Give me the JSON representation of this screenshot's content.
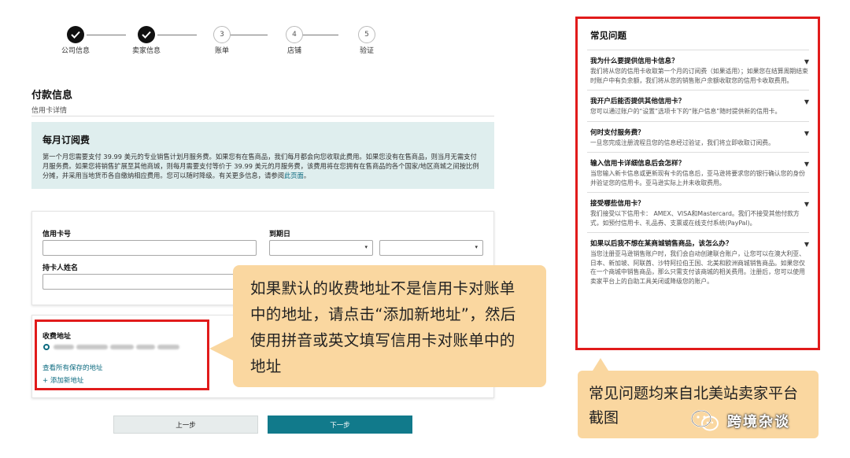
{
  "stepper": {
    "steps": [
      {
        "label": "公司信息",
        "number": "1",
        "state": "done"
      },
      {
        "label": "卖家信息",
        "number": "2",
        "state": "done"
      },
      {
        "label": "账单",
        "number": "3",
        "state": "todo"
      },
      {
        "label": "店铺",
        "number": "4",
        "state": "todo"
      },
      {
        "label": "验证",
        "number": "5",
        "state": "todo"
      }
    ]
  },
  "payment": {
    "title": "付款信息",
    "subtitle": "信用卡详情",
    "fee_title": "每月订阅费",
    "fee_text": "第一个月您需要支付 39.99 美元的专业销售计划月服务费。如果您有在售商品，我们每月都会向您收取此费用。如果您没有在售商品，则当月无需支付月服务费。如果您将销售扩展至其他商城，则每月需要支付等价于 39.99 美元的月服务费，该费用将在您拥有在售商品的各个国家/地区商城之间按比例分摊，并采用当地货币各自缴纳相应费用。您可以随时降级。有关更多信息，请参阅",
    "fee_link": "此页面",
    "fee_end": "。"
  },
  "form": {
    "card_number_label": "信用卡号",
    "card_number_value": "",
    "expiry_label": "到期日",
    "expiry_month": "",
    "expiry_year": "",
    "holder_label": "持卡人姓名",
    "holder_value": ""
  },
  "billing": {
    "label": "收费地址",
    "view_all": "查看所有保存的地址",
    "add_new": "+ 添加新地址"
  },
  "buttons": {
    "prev": "上一步",
    "next": "下一步"
  },
  "callout": {
    "text": "如果默认的收费地址不是信用卡对账单中的地址，请点击“添加新地址”，然后使用拼音或英文填写信用卡对账单中的地址"
  },
  "faq": {
    "title": "常见问题",
    "items": [
      {
        "q": "我为什么要提供信用卡信息？",
        "a": "我们将从您的信用卡收取第一个月的订阅费（如果适用）；如果您在结算周期结束时账户中有负余额，我们将从您的销售账户余额收取您的信用卡收取费用。"
      },
      {
        "q": "我开户后能否提供其他信用卡？",
        "a": "您可以通过账户的“设置”选项卡下的“账户信息”随时提供新的信用卡。"
      },
      {
        "q": "何时支付服务费？",
        "a": "一旦您完成注册流程且您的信息经过验证，我们将立即收取订阅费。"
      },
      {
        "q": "输入信用卡详细信息后会怎样？",
        "a": "当您输入新卡信息或更新现有卡的信息后，亚马逊将要求您的银行确认您的身份并验证您的信用卡。亚马逊实际上并未收取费用。"
      },
      {
        "q": "接受哪些信用卡？",
        "a": "我们接受以下信用卡： AMEX、VISA和Mastercard。我们不接受其他付款方式，如预付信用卡、礼品券、支票或在线支付系统(PayPal)。"
      },
      {
        "q": "如果以后我不想在某商城销售商品，该怎么办？",
        "a": "当您注册亚马逊销售账户时，我们会自动创建联合账户，让您可以在澳大利亚、日本、新加坡、阿联酋、沙特阿拉伯王国、北美和欧洲商城销售商品。如果您仅在一个商城中销售商品，那么只需支付该商城的相关费用。注册后，您可以使用卖家平台上的自助工具关闭或降级您的账户。"
      }
    ]
  },
  "faq_note": {
    "text": "常见问题均来自北美站卖家平台截图"
  },
  "watermark": {
    "text": "跨境杂谈",
    "icon": "wechat-icon"
  },
  "colors": {
    "highlight_red": "#e11b1b",
    "callout_orange": "#fad7a0",
    "teal": "#117a8b",
    "fee_bg": "#dfeeee"
  }
}
